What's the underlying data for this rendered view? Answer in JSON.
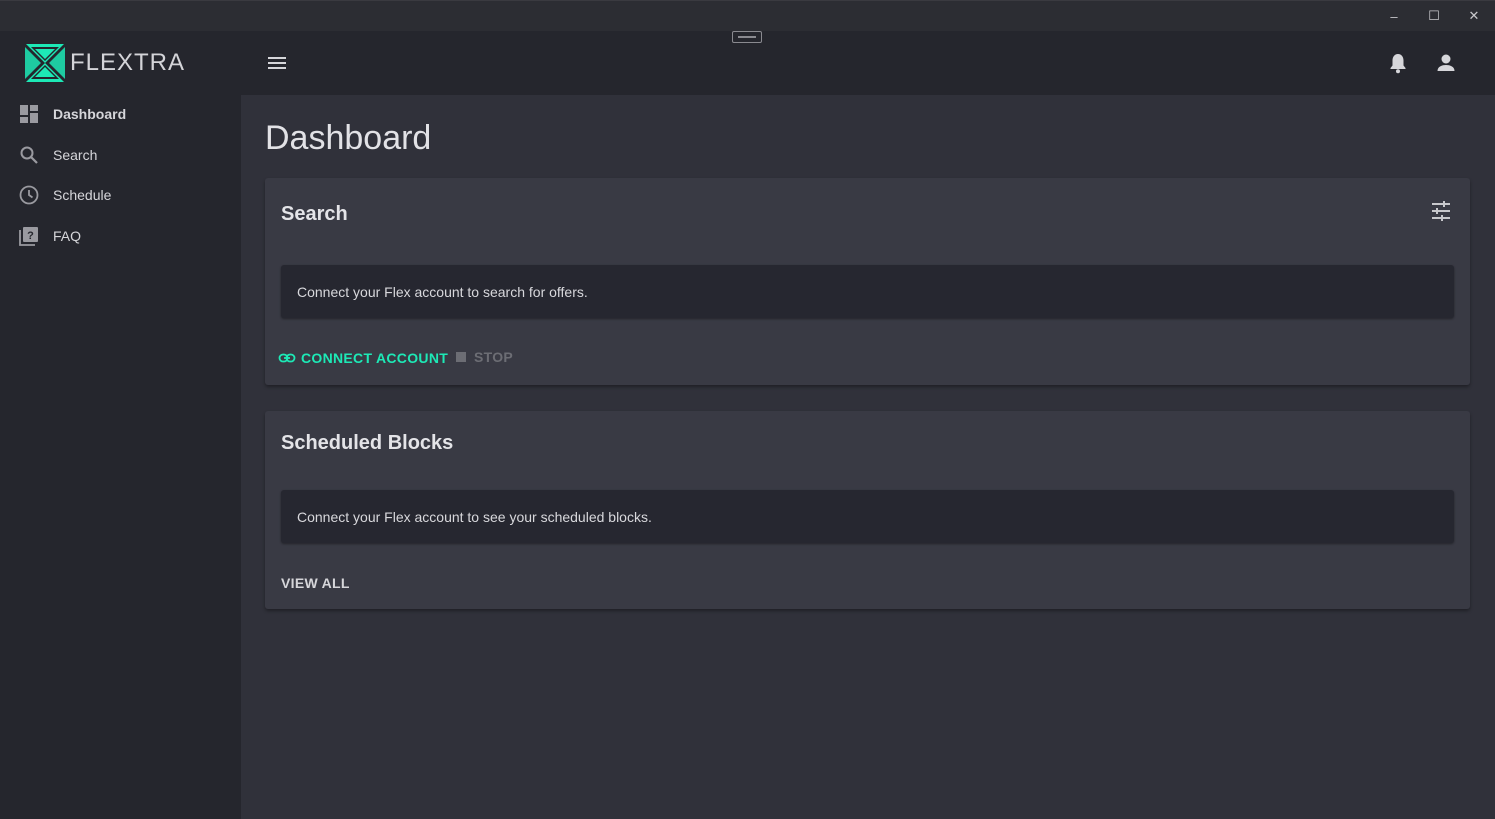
{
  "window": {
    "minimize": "–",
    "maximize": "☐",
    "close": "✕"
  },
  "brand": {
    "name": "FLEXTRA",
    "accent": "#1de9b6"
  },
  "sidebar": {
    "items": [
      {
        "label": "Dashboard",
        "icon": "dashboard-icon"
      },
      {
        "label": "Search",
        "icon": "search-icon"
      },
      {
        "label": "Schedule",
        "icon": "clock-icon"
      },
      {
        "label": "FAQ",
        "icon": "question-library-icon"
      }
    ]
  },
  "topbar": {
    "menu_icon": "hamburger-menu-icon",
    "notifications_icon": "bell-icon",
    "account_icon": "person-icon"
  },
  "main": {
    "title": "Dashboard",
    "search_card": {
      "title": "Search",
      "filter_icon": "tune-icon",
      "message": "Connect your Flex account to search for offers.",
      "connect_label": "CONNECT ACCOUNT",
      "stop_label": "STOP"
    },
    "blocks_card": {
      "title": "Scheduled Blocks",
      "message": "Connect your Flex account to see your scheduled blocks.",
      "view_all_label": "VIEW ALL"
    }
  }
}
